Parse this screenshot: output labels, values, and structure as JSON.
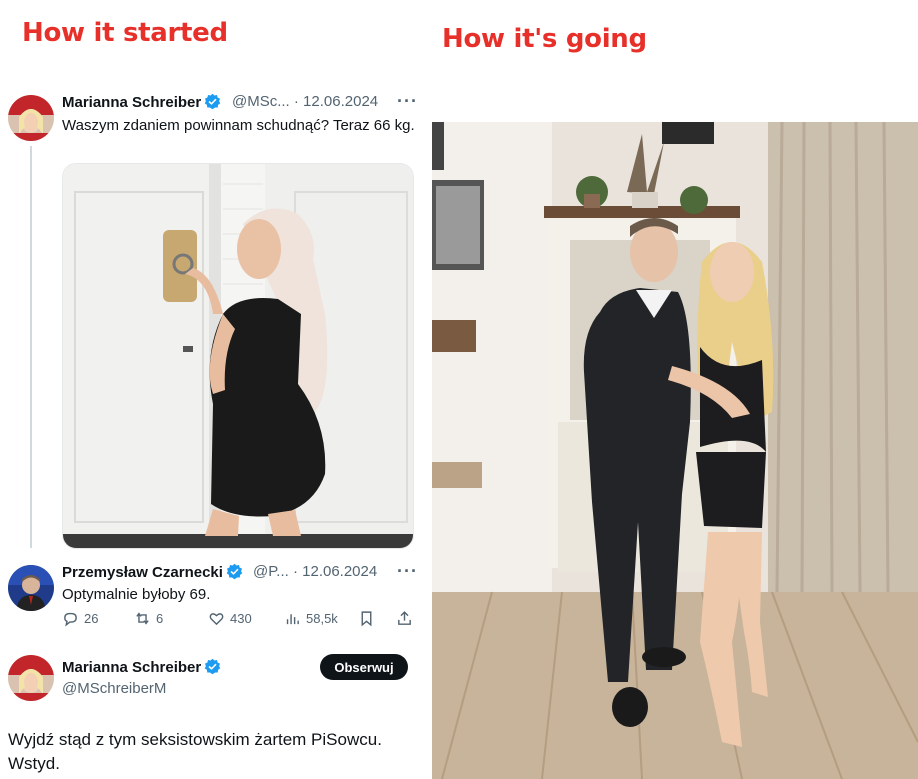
{
  "headings": {
    "left": "How it started",
    "right": "How it's going"
  },
  "tweet": {
    "author_name": "Marianna Schreiber",
    "handle_date": "@MSc... · 12.06.2024",
    "more": "···",
    "text": "Waszym zdaniem powinnam schudnąć? Teraz 66 kg.",
    "avatar_icon": "user-avatar",
    "media_icon": "selfie-photo"
  },
  "reply_tweet": {
    "author_name": "Przemysław Czarnecki",
    "handle_date": "@P... · 12.06.2024",
    "more": "···",
    "text": "Optymalnie byłoby 69.",
    "actions": {
      "replies": "26",
      "retweets": "6",
      "likes": "430",
      "views": "58,5k"
    }
  },
  "quote": {
    "author_name": "Marianna Schreiber",
    "handle": "@MSchreiberM",
    "follow_label": "Obserwuj",
    "text": "Wyjdź stąd z tym seksistowskim żartem PiSowcu. Wstyd."
  },
  "colors": {
    "heading": "#e8302a",
    "verified": "#1d9bf0",
    "text": "#0f1419",
    "muted": "#536471"
  }
}
